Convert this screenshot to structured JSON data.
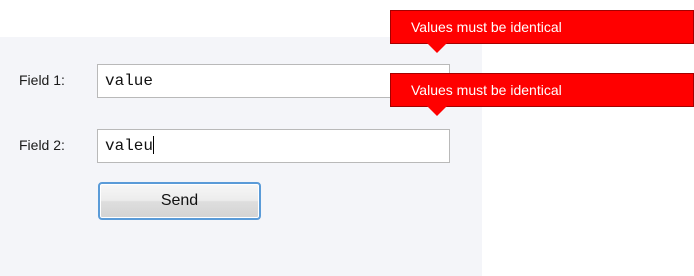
{
  "form": {
    "field1": {
      "label": "Field 1:",
      "value": "value"
    },
    "field2": {
      "label": "Field 2:",
      "value": "valeu"
    },
    "send_label": "Send"
  },
  "tooltips": {
    "field1_error": "Values must be identical",
    "field2_error": "Values must be identical"
  },
  "colors": {
    "tooltip_background": "#ff0000",
    "panel_background": "#f4f5f9",
    "button_border": "#5a9bd8"
  }
}
